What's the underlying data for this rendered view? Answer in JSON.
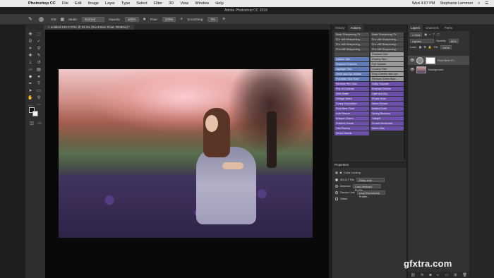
{
  "menubar": {
    "app": "Photoshop CC",
    "items": [
      "File",
      "Edit",
      "Image",
      "Layer",
      "Type",
      "Select",
      "Filter",
      "3D",
      "View",
      "Window",
      "Help"
    ],
    "window_title": "Adobe Photoshop CC 2019",
    "clock": "Wed 4:07 PM",
    "user": "Stephanie Lemmon"
  },
  "options": {
    "brush_size": "409",
    "mode_label": "Mode:",
    "mode_value": "Normal",
    "opacity_label": "Opacity:",
    "opacity_value": "100%",
    "flow_label": "Flow:",
    "flow_value": "100%",
    "smoothing_label": "Smoothing:",
    "smoothing_value": "0%"
  },
  "document_tab": "untitled-133-2.CR2 @ 33.3% (Root Beer Float, RGB/16) *",
  "actions_panel": {
    "tabs": [
      "History",
      "Actions"
    ],
    "rows": [
      [
        "Basic Sharpening 75...",
        "Basic Sharpening 75..."
      ],
      [
        "Pro LAB Sharpening...",
        "Pro LAB Sharpening..."
      ],
      [
        "Pro LAB Sharpening...",
        "Pro LAB Sharpening..."
      ],
      [
        "Pro LAB Sharpening...",
        "Pro LAB Sharpening..."
      ],
      [
        "",
        "Flawless Skin"
      ],
      [
        "Lighten Skin",
        "Peachy Skin"
      ],
      [
        "Sharpen Features",
        "Eye Sparkle"
      ],
      [
        "Highlight Skin",
        "Contour Skin"
      ],
      [
        "Teeth and Eye Whiten",
        "Rosy Cheeks and Lips"
      ],
      [
        "Porcelain Skin Tone",
        "Remove Green Blad..."
      ],
      [
        "Remove Red Skin",
        "Softly Saturate"
      ],
      [
        "Pop of Contrast",
        "Emerald Greens"
      ],
      [
        "Dark Matte",
        "Light and Airy"
      ],
      [
        "Vintage Wash",
        "Purple Haze"
      ],
      [
        "Sunny Disposition",
        "Warm Sunset"
      ],
      [
        "Root Beer Float",
        "Matted Earth"
      ],
      [
        "Artic Breeze",
        "Spring Blossom"
      ],
      [
        "Antique Charm",
        "Twilight"
      ],
      [
        "Sublime Ocean",
        "Sunset Boulevard"
      ],
      [
        "Just Peachy",
        "Warm Kiss"
      ],
      [
        "Desert Sands",
        ""
      ]
    ]
  },
  "properties": {
    "title": "Properties",
    "panel_label": "Color Lookup",
    "file_label": "3DLUT File",
    "file_value": "2Strip.look",
    "abstract_label": "Abstract",
    "abstract_value": "Load Abstract Profile...",
    "devicelink_label": "Device Link",
    "devicelink_value": "Load DeviceLink Profile...",
    "dither_label": "Dither"
  },
  "layers": {
    "tabs": [
      "Layers",
      "Channels",
      "Paths"
    ],
    "kind_label": "Kind",
    "blend_mode": "Lighten",
    "opacity_label": "Opacity:",
    "opacity_value": "80%",
    "lock_label": "Lock:",
    "fill_label": "Fill:",
    "fill_value": "100%",
    "items": [
      "Root Beer Fl...",
      "Background"
    ]
  },
  "watermark": "gfxtra.com"
}
